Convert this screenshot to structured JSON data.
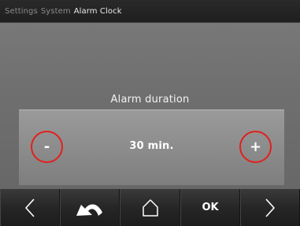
{
  "breadcrumb": [
    "Settings",
    "System",
    "Alarm Clock"
  ],
  "setting": {
    "label": "Alarm duration",
    "value": "30 min."
  },
  "stepper": {
    "minus_label": "-",
    "plus_label": "+"
  },
  "nav": {
    "ok_label": "OK"
  },
  "icons": {
    "prev": "left-arrow-icon",
    "back": "back-arrow-icon",
    "home": "home-icon",
    "next": "right-arrow-icon"
  },
  "colors": {
    "highlight": "#e2201c",
    "topbar": "#242424",
    "navbar": "#262626",
    "background": "#707070"
  }
}
